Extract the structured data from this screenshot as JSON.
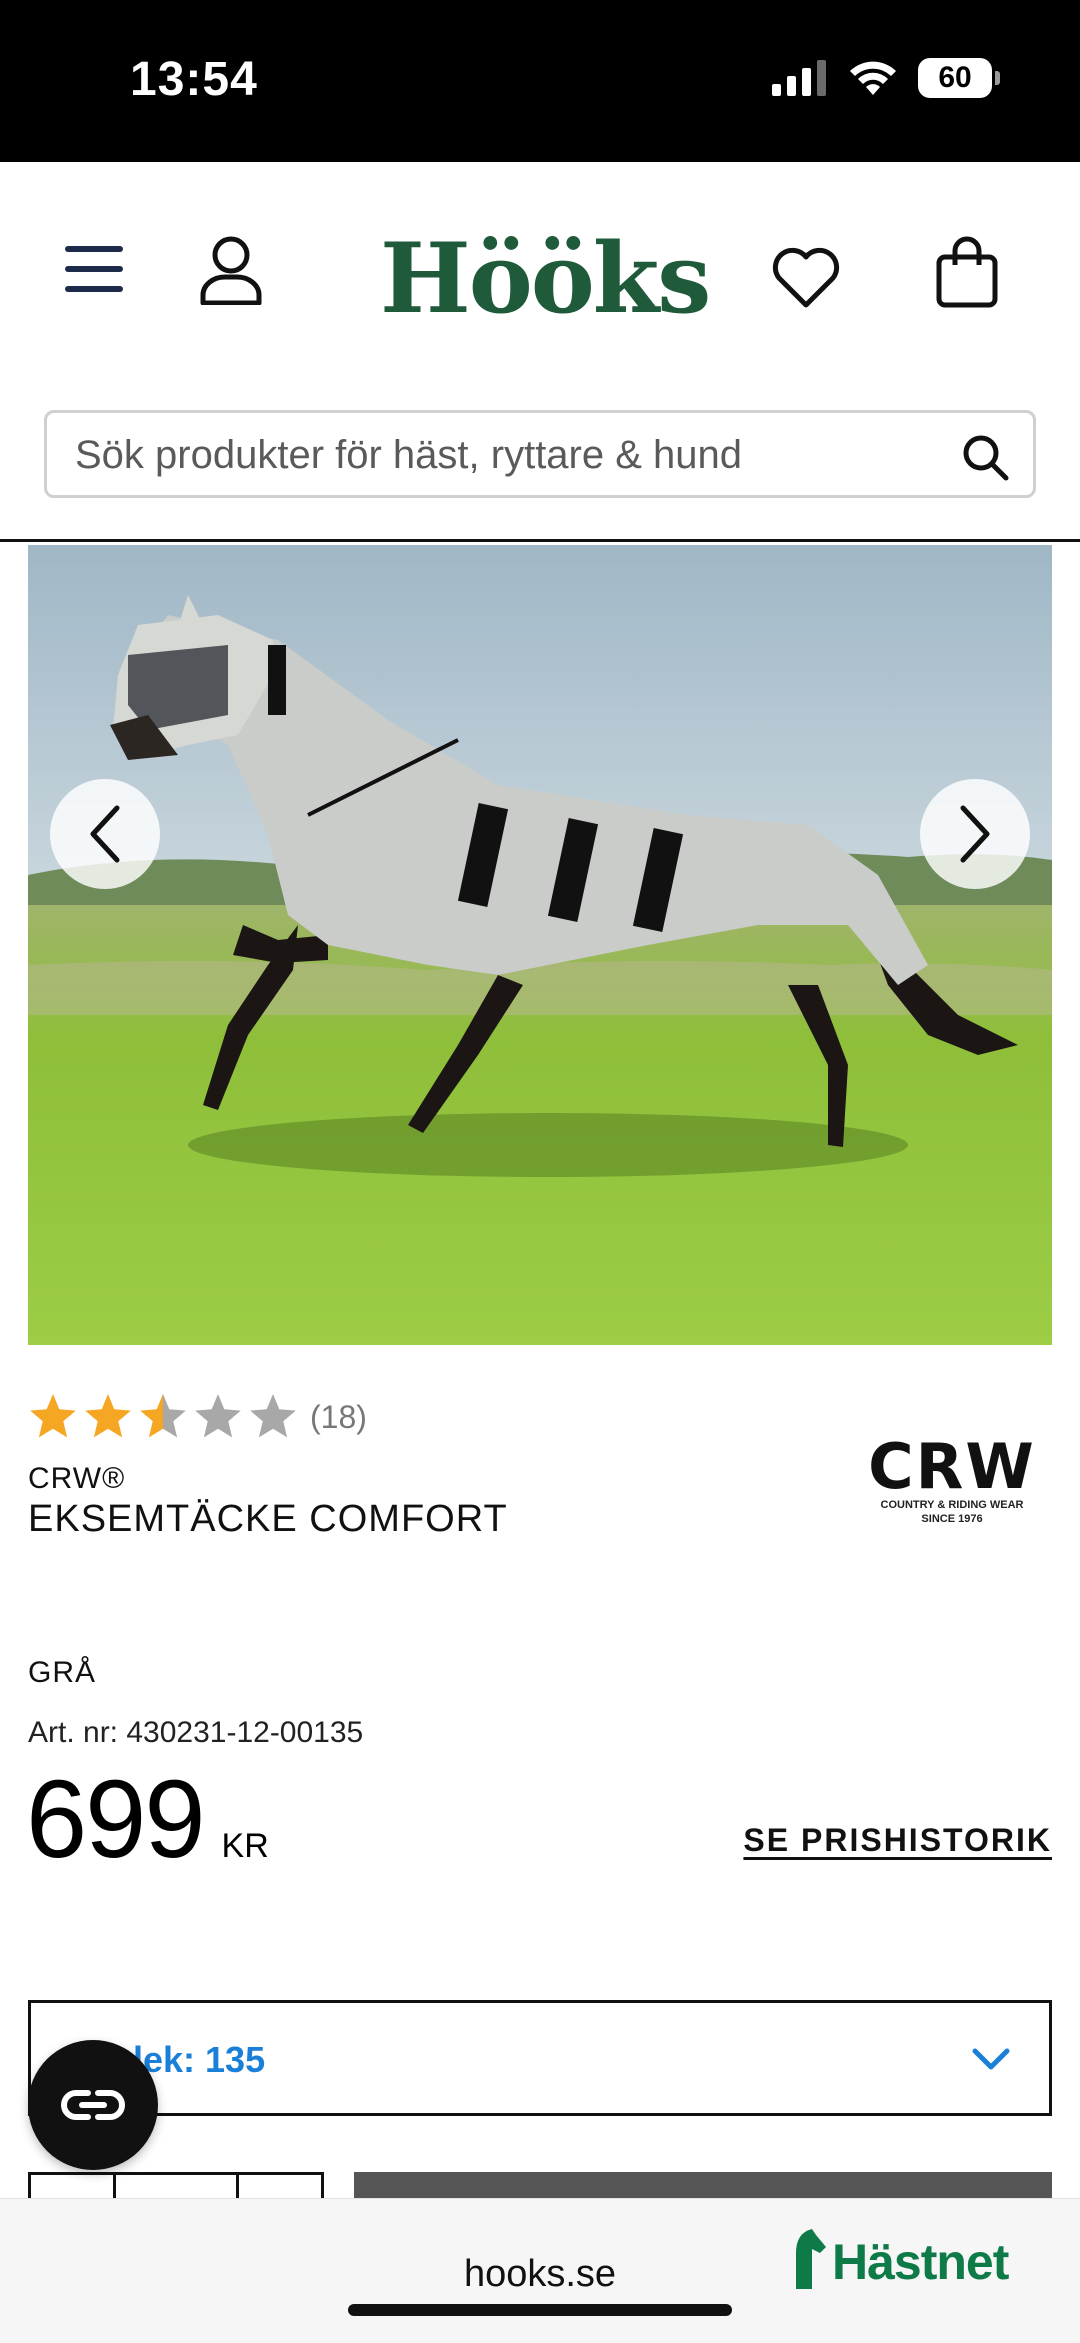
{
  "status_bar": {
    "time": "13:54",
    "battery": "60"
  },
  "header": {
    "logo": "Hööks",
    "search_placeholder": "Sök produkter för häst, ryttare & hund"
  },
  "product": {
    "rating_value": 2.5,
    "rating_max": 5,
    "rating_count": "(18)",
    "brand": "CRW®",
    "name": "EKSEMTÄCKE COMFORT",
    "brand_logo_text": "CRW",
    "brand_logo_sub_1": "COUNTRY & RIDING WEAR",
    "brand_logo_sub_2": "SINCE 1976",
    "color": "GRÅ",
    "art_nr": "Art. nr: 430231-12-00135",
    "price": "699",
    "currency": "KR",
    "price_history_link": "SE PRISHISTORIK",
    "size_label": "Storlek: 135"
  },
  "browser": {
    "url": "hooks.se",
    "partner": "Hästnet"
  },
  "colors": {
    "brand_green": "#1f5a3a",
    "star": "#f5a623",
    "link_blue": "#1a7fd6",
    "partner_green": "#0d7a47"
  }
}
